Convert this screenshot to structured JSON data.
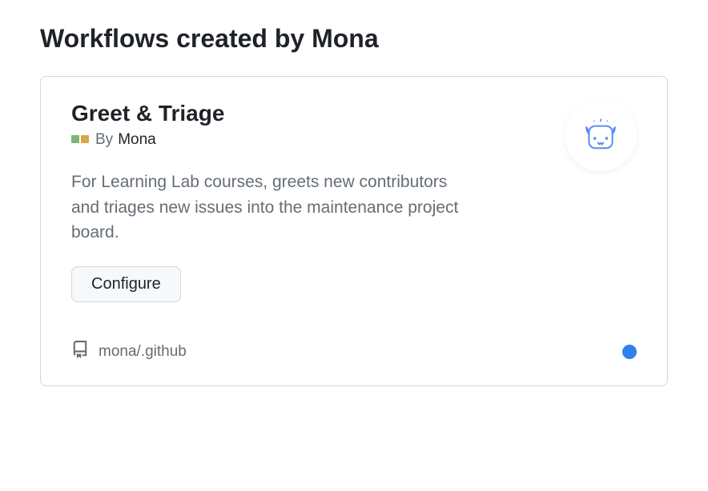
{
  "header": {
    "title": "Workflows created by Mona"
  },
  "workflow": {
    "title": "Greet & Triage",
    "by_label": "By",
    "author": "Mona",
    "description": "For Learning Lab courses, greets new contributors and triages new issues into the maintenance project board.",
    "configure_label": "Configure",
    "repo": "mona/.github",
    "status_color": "#2f80ed"
  }
}
